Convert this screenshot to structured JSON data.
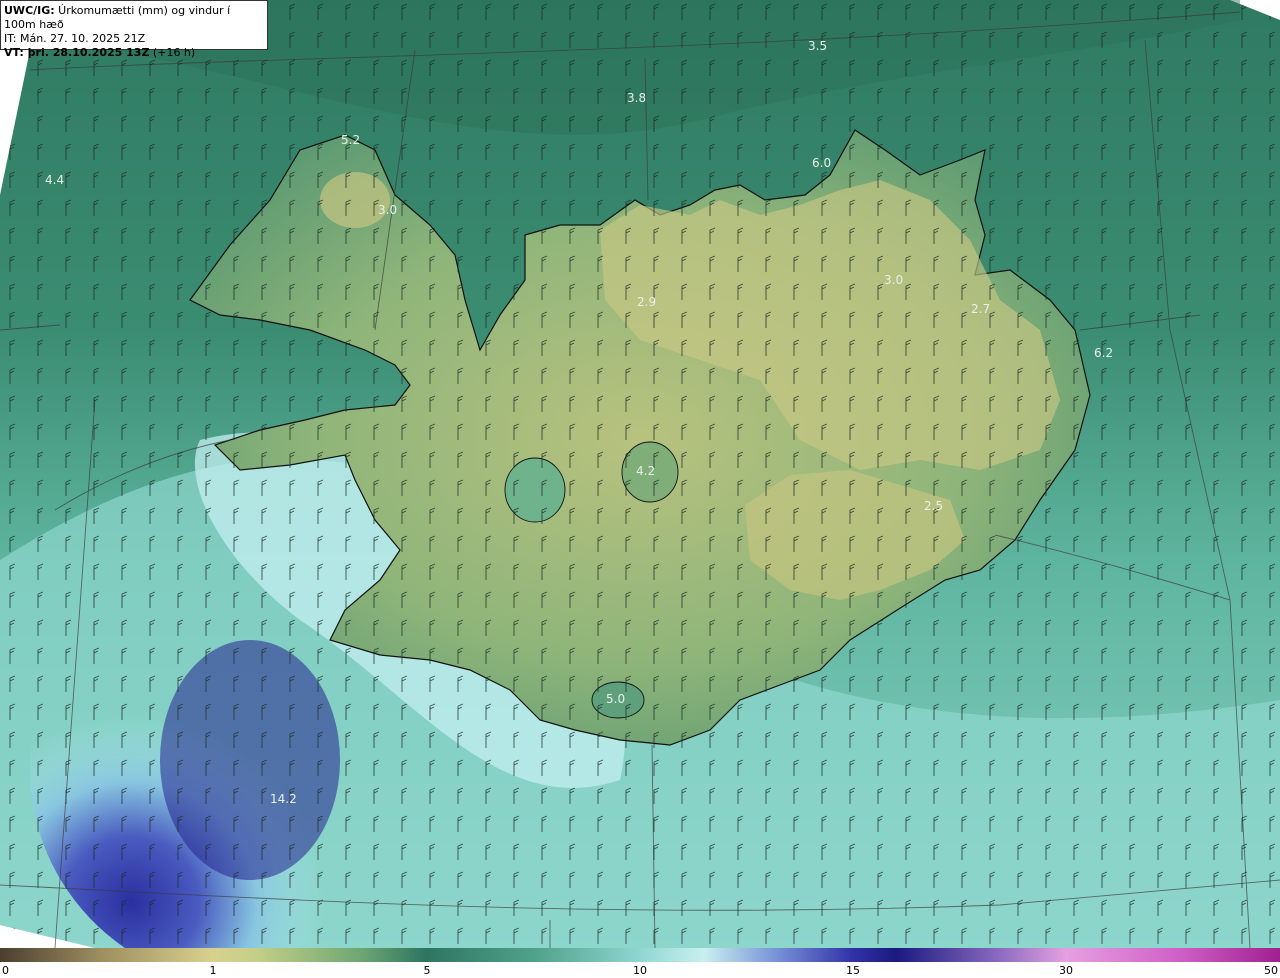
{
  "header": {
    "line1_bold": "UWC/IG:",
    "line1_rest": " Úrkomumætti (mm) og vindur í 100m hæð",
    "line2": "IT: Mán. 27. 10. 2025 21Z",
    "line3_bold": "VT: þri. 28.10.2025 13Z",
    "line3_rest": " (+16 h)"
  },
  "colorbar": {
    "ticks": [
      "0",
      "1",
      "5",
      "10",
      "15",
      "30",
      "50"
    ]
  },
  "map_labels": [
    {
      "name": "label-3-5",
      "text": "3.5"
    },
    {
      "name": "label-3-8",
      "text": "3.8"
    },
    {
      "name": "label-5-2",
      "text": "5.2"
    },
    {
      "name": "label-4-4",
      "text": "4.4"
    },
    {
      "name": "label-3-0-west",
      "text": "3.0"
    },
    {
      "name": "label-6-0",
      "text": "6.0"
    },
    {
      "name": "label-3-0-north",
      "text": "3.0"
    },
    {
      "name": "label-2-9",
      "text": "2.9"
    },
    {
      "name": "label-2-7",
      "text": "2.7"
    },
    {
      "name": "label-6-2",
      "text": "6.2"
    },
    {
      "name": "label-4-2",
      "text": "4.2"
    },
    {
      "name": "label-2-5",
      "text": "2.5"
    },
    {
      "name": "label-5-0",
      "text": "5.0"
    },
    {
      "name": "label-14-2",
      "text": "14.2"
    }
  ]
}
